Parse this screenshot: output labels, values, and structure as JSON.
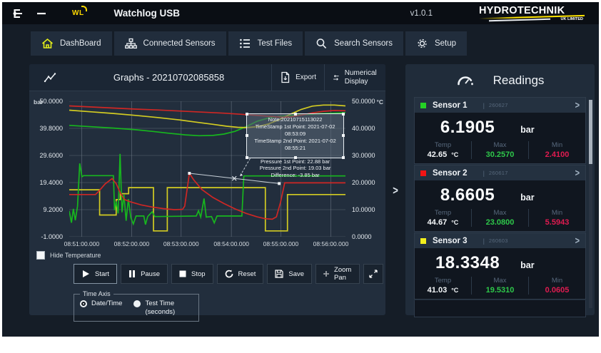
{
  "titlebar": {
    "title": "Watchlog USB",
    "version": "v1.0.1",
    "brand": "HYDROTECHNIK",
    "brand_sub": "UK LIMITED"
  },
  "nav": {
    "items": [
      {
        "label": "DashBoard",
        "icon": "home-icon"
      },
      {
        "label": "Connected Sensors",
        "icon": "network-icon"
      },
      {
        "label": "Test Files",
        "icon": "list-icon"
      },
      {
        "label": "Search Sensors",
        "icon": "search-icon"
      },
      {
        "label": "Setup",
        "icon": "gear-icon"
      }
    ]
  },
  "graph": {
    "title": "Graphs - 20210702085858",
    "export_label": "Export",
    "numerical_label": "Numerical Display",
    "hide_temperature_label": "Hide Temperature",
    "controls": {
      "start": "Start",
      "pause": "Pause",
      "stop": "Stop",
      "reset": "Reset",
      "save": "Save",
      "zoom_pan": "Zoom Pan"
    },
    "time_axis": {
      "legend": "Time Axis",
      "options": [
        {
          "label": "Date/Time",
          "selected": true
        },
        {
          "label": "Test Time (seconds)",
          "selected": false
        }
      ]
    },
    "tooltip": {
      "lines": [
        "Note:20210715113022",
        "TimeStamp 1st Point: 2021-07-02 08:53:09",
        "TimeStamp 2nd Point: 2021-07-02 08:55:21",
        "",
        "Pressure 1st Point: 22.88 bar",
        "Pressure 2nd Point: 19.03 bar",
        "Difference: -3.85 bar"
      ]
    },
    "collapse_chevron": ">"
  },
  "chart_data": {
    "type": "line",
    "title": "Graphs - 20210702085858",
    "left_axis": {
      "unit": "bar",
      "range": [
        -1,
        50
      ],
      "ticks": [
        "50.0000",
        "39.8000",
        "29.6000",
        "19.4000",
        "9.2000",
        "-1.0000"
      ]
    },
    "right_axis": {
      "unit": "°C",
      "range": [
        0,
        50
      ],
      "ticks": [
        "50.0000",
        "40.0000",
        "30.0000",
        "20.0000",
        "10.0000",
        "0.0000"
      ]
    },
    "x_axis": {
      "ticks": [
        "08:51:00.000",
        "08:52:00.000",
        "08:53:00.000",
        "08:54:00.000",
        "08:55:00.000",
        "08:56:00.000"
      ]
    },
    "grid": {
      "x_percent": [
        4.5,
        22.6,
        40.5,
        58.7,
        76.6,
        94.7
      ],
      "y_percent": [
        0,
        20,
        40,
        60,
        80,
        100
      ]
    },
    "series": [
      {
        "name": "sensor3-temperature",
        "axis": "right",
        "color": "#17b61e",
        "points": [
          [
            0,
            41.1
          ],
          [
            8,
            40.6
          ],
          [
            16,
            40.1
          ],
          [
            24,
            39.5
          ],
          [
            30,
            38.9
          ],
          [
            36,
            38.2
          ],
          [
            42,
            37.6
          ],
          [
            47,
            37.3
          ],
          [
            52,
            37.4
          ],
          [
            56,
            37.9
          ],
          [
            60,
            38.9
          ],
          [
            64,
            40.6
          ],
          [
            68,
            42.6
          ],
          [
            72,
            43.8
          ],
          [
            76,
            44.4
          ],
          [
            82,
            44.9
          ],
          [
            90,
            45.4
          ],
          [
            100,
            45.8
          ]
        ]
      },
      {
        "name": "sensor2-temperature",
        "axis": "right",
        "color": "#d3cc22",
        "points": [
          [
            0,
            46.7
          ],
          [
            8,
            46.1
          ],
          [
            16,
            45.5
          ],
          [
            24,
            44.8
          ],
          [
            32,
            44.0
          ],
          [
            40,
            43.1
          ],
          [
            46,
            42.3
          ],
          [
            52,
            41.5
          ],
          [
            57,
            40.8
          ],
          [
            61,
            40.4
          ],
          [
            64,
            40.3
          ],
          [
            68,
            40.6
          ],
          [
            72,
            41.6
          ],
          [
            76,
            43.2
          ],
          [
            80,
            45.2
          ],
          [
            84,
            47.0
          ],
          [
            88,
            48.2
          ],
          [
            92,
            48.6
          ],
          [
            96,
            48.6
          ],
          [
            100,
            48.3
          ]
        ]
      },
      {
        "name": "sensor1-temperature",
        "axis": "right",
        "color": "#cf2724",
        "points": [
          [
            0,
            48.3
          ],
          [
            8,
            47.9
          ],
          [
            16,
            47.5
          ],
          [
            24,
            47.1
          ],
          [
            32,
            46.8
          ],
          [
            40,
            46.4
          ],
          [
            48,
            46.0
          ],
          [
            56,
            45.6
          ],
          [
            62,
            45.2
          ],
          [
            68,
            44.8
          ],
          [
            73,
            44.4
          ],
          [
            77,
            44.1
          ],
          [
            80,
            44.2
          ],
          [
            84,
            44.9
          ],
          [
            88,
            45.7
          ],
          [
            92,
            46.3
          ],
          [
            96,
            46.6
          ],
          [
            100,
            46.5
          ]
        ]
      },
      {
        "name": "sensor3-pressure",
        "axis": "left",
        "color": "#d3cc22",
        "points": [
          [
            0,
            16.7
          ],
          [
            11,
            16.7
          ],
          [
            11,
            7.2
          ],
          [
            17,
            7.2
          ],
          [
            17,
            13.0
          ],
          [
            18.5,
            13.0
          ],
          [
            18.5,
            15.2
          ],
          [
            21.5,
            15.2
          ],
          [
            21.5,
            17.5
          ],
          [
            30.5,
            17.5
          ],
          [
            30.5,
            1.2
          ],
          [
            35.5,
            1.2
          ],
          [
            35.5,
            17.5
          ],
          [
            71,
            17.5
          ],
          [
            71,
            1.2
          ],
          [
            79,
            1.2
          ],
          [
            79,
            14.9
          ],
          [
            100,
            14.9
          ]
        ]
      },
      {
        "name": "sensor1-pressure",
        "axis": "left",
        "color": "#17b61e",
        "points": [
          [
            0,
            8.7
          ],
          [
            0.8,
            4.3
          ],
          [
            1.5,
            9.5
          ],
          [
            2.2,
            5.2
          ],
          [
            3,
            10.5
          ],
          [
            3.8,
            26.6
          ],
          [
            4.6,
            21.6
          ],
          [
            5.2,
            22.0
          ],
          [
            16,
            22.0
          ],
          [
            16.4,
            9.0
          ],
          [
            17,
            12.3
          ],
          [
            17.7,
            7.8
          ],
          [
            18.4,
            30.2
          ],
          [
            19.1,
            8.2
          ],
          [
            19.8,
            14.8
          ],
          [
            20.6,
            5.0
          ],
          [
            21.4,
            13.2
          ],
          [
            22.3,
            6.2
          ],
          [
            23.2,
            3.8
          ],
          [
            24.2,
            6.8
          ],
          [
            27,
            6.8
          ],
          [
            27.6,
            3.6
          ],
          [
            28.4,
            6.6
          ],
          [
            30,
            8.4
          ],
          [
            31,
            6.6
          ],
          [
            46,
            6.8
          ],
          [
            46.8,
            8.8
          ],
          [
            47.6,
            6.4
          ],
          [
            48.8,
            13.4
          ],
          [
            49.6,
            6.4
          ],
          [
            51.5,
            6.6
          ],
          [
            52.5,
            4.2
          ],
          [
            53.5,
            6.8
          ],
          [
            62.5,
            6.8
          ],
          [
            63.2,
            21.9
          ],
          [
            100,
            21.9
          ]
        ]
      },
      {
        "name": "sensor2-pressure",
        "axis": "left",
        "color": "#cf2724",
        "points": [
          [
            0,
            14.9
          ],
          [
            9.5,
            14.9
          ],
          [
            11,
            16.5
          ],
          [
            13,
            18.9
          ],
          [
            15.5,
            20.9
          ],
          [
            17,
            19.0
          ],
          [
            18.5,
            15.5
          ],
          [
            20,
            13.0
          ],
          [
            22,
            12.2
          ],
          [
            26,
            11.0
          ],
          [
            30,
            10.2
          ],
          [
            34,
            9.6
          ],
          [
            38,
            9.2
          ],
          [
            41,
            9.3
          ],
          [
            41.8,
            10.5
          ],
          [
            43.5,
            22.88
          ],
          [
            45,
            20.5
          ],
          [
            48,
            16.8
          ],
          [
            52,
            13.8
          ],
          [
            56,
            11.5
          ],
          [
            60,
            9.5
          ],
          [
            64,
            7.8
          ],
          [
            68,
            6.5
          ],
          [
            71,
            5.8
          ],
          [
            73.5,
            5.6
          ],
          [
            75,
            6.5
          ],
          [
            76.5,
            12.0
          ],
          [
            78,
            19.3
          ],
          [
            100,
            19.3
          ]
        ]
      }
    ],
    "measurement": {
      "axis": "left",
      "p1": [
        43.5,
        22.88
      ],
      "p2": [
        76,
        19.03
      ],
      "pointer_from": [
        65.5,
        28.5
      ],
      "pointer_to": [
        61.8,
        21.8
      ]
    },
    "legend_position": "none",
    "grid_on": true
  },
  "readings": {
    "title": "Readings",
    "sensors": [
      {
        "name": "Sensor 1",
        "sep": "|",
        "id": "260627",
        "chevron": ">",
        "color": "#25d125",
        "value": "6.1905",
        "unit": "bar",
        "temp_label": "Temp",
        "temp": "42.65",
        "temp_unit": "°C",
        "max_label": "Max",
        "max": "30.2570",
        "min_label": "Min",
        "min": "2.4100"
      },
      {
        "name": "Sensor 2",
        "sep": "|",
        "id": "260617",
        "chevron": ">",
        "color": "#f31414",
        "value": "8.6605",
        "unit": "bar",
        "temp_label": "Temp",
        "temp": "44.67",
        "temp_unit": "°C",
        "max_label": "Max",
        "max": "23.0800",
        "min_label": "Min",
        "min": "5.5943"
      },
      {
        "name": "Sensor 3",
        "sep": "|",
        "id": "260603",
        "chevron": ">",
        "color": "#f2ef1d",
        "value": "18.3348",
        "unit": "bar",
        "temp_label": "Temp",
        "temp": "41.03",
        "temp_unit": "°C",
        "max_label": "Max",
        "max": "19.5310",
        "min_label": "Min",
        "min": "0.0605"
      }
    ]
  }
}
